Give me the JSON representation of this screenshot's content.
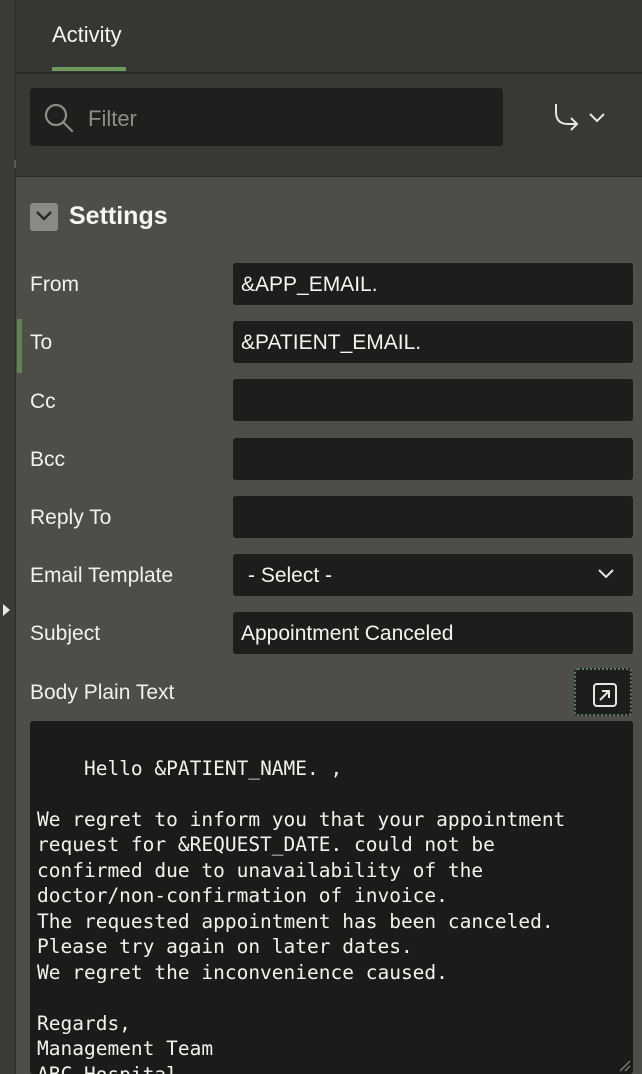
{
  "header": {
    "tab_label": "Activity"
  },
  "filter": {
    "placeholder": "Filter"
  },
  "settings": {
    "title": "Settings",
    "fields": {
      "from": {
        "label": "From",
        "value": "&APP_EMAIL."
      },
      "to": {
        "label": "To",
        "value": "&PATIENT_EMAIL."
      },
      "cc": {
        "label": "Cc",
        "value": ""
      },
      "bcc": {
        "label": "Bcc",
        "value": ""
      },
      "reply_to": {
        "label": "Reply To",
        "value": ""
      },
      "email_template": {
        "label": "Email Template",
        "value": "- Select -"
      },
      "subject": {
        "label": "Subject",
        "value": "Appointment Canceled"
      },
      "body": {
        "label": "Body Plain Text",
        "value": "Hello &PATIENT_NAME. ,\n\nWe regret to inform you that your appointment\nrequest for &REQUEST_DATE. could not be\nconfirmed due to unavailability of the\ndoctor/non-confirmation of invoice.\nThe requested appointment has been canceled.\nPlease try again on later dates.\nWe regret the inconvenience caused.\n\nRegards,\nManagement Team\nABC Hospital"
      }
    }
  },
  "icons": {
    "search": "search-icon",
    "route": "route-arrow-icon",
    "chevron": "chevron-down-icon",
    "collapse": "collapse-chevron-icon",
    "expand": "expand-icon",
    "resize": "resize-handle-icon"
  },
  "colors": {
    "accent": "#6f9a5f",
    "field_bg": "#1d1d1b",
    "panel_bg": "#4d4e48"
  }
}
